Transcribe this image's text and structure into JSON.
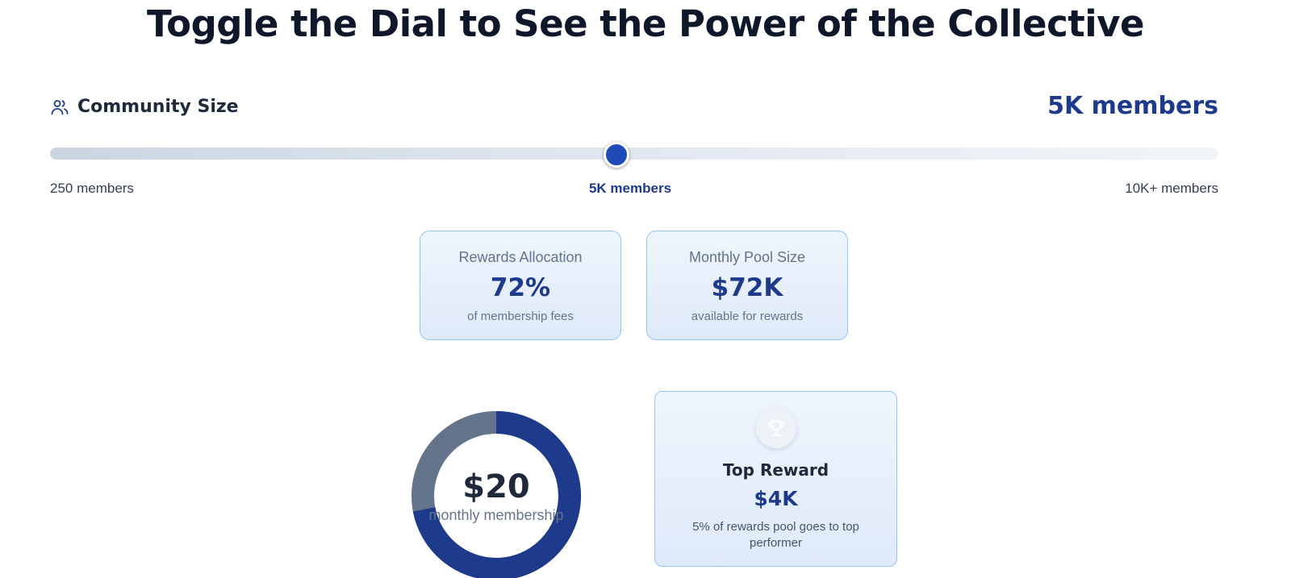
{
  "headline": "Toggle the Dial to See the Power of the Collective",
  "community": {
    "label": "Community Size",
    "label_icon": "users-icon",
    "value_display": "5K members"
  },
  "slider": {
    "level": 0.485,
    "min_label": "250 members",
    "mid_label": "5K members",
    "max_label": "10K+ members",
    "track_start_color": "#cbd5e1",
    "track_end_color": "#f1f5f9",
    "thumb_color": "#1e4bb8"
  },
  "stats": [
    {
      "title": "Rewards Allocation",
      "value": "72%",
      "note": "of membership fees"
    },
    {
      "title": "Monthly Pool Size",
      "value": "$72K",
      "note": "available for rewards"
    }
  ],
  "membership": {
    "value": "$20",
    "label": "monthly membership",
    "rewards_share": 0.72,
    "rewards_color": "#1e3a8a",
    "remainder_color": "#64748b"
  },
  "reward": {
    "icon": "trophy-icon",
    "title": "Top Reward",
    "value": "$4K",
    "note": "5% of rewards pool goes to top performer"
  },
  "colors": {
    "accent": "#1e3a8a",
    "heading": "#0f172a",
    "card_border": "#93c5fd",
    "card_background": "#e6effb"
  }
}
